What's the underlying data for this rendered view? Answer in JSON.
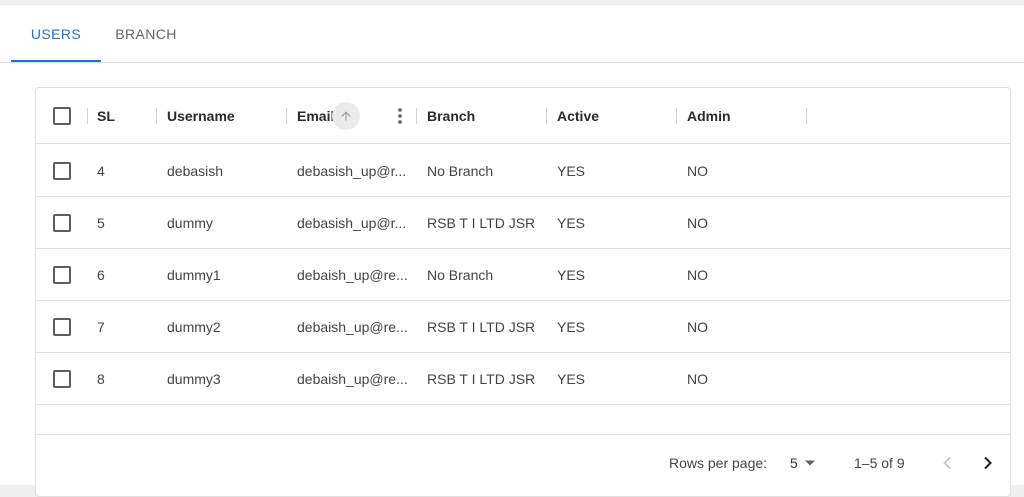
{
  "tabs": [
    {
      "label": "USERS",
      "active": true
    },
    {
      "label": "BRANCH",
      "active": false
    }
  ],
  "table": {
    "columns": [
      "SL",
      "Username",
      "Email",
      "Branch",
      "Active",
      "Admin"
    ],
    "rows": [
      {
        "sl": "4",
        "username": "debasish",
        "email": "debasish_up@r...",
        "branch": "No Branch",
        "active": "YES",
        "admin": "NO"
      },
      {
        "sl": "5",
        "username": "dummy",
        "email": "debasish_up@r...",
        "branch": "RSB T I LTD JSR",
        "active": "YES",
        "admin": "NO"
      },
      {
        "sl": "6",
        "username": "dummy1",
        "email": "debaish_up@re...",
        "branch": "No Branch",
        "active": "YES",
        "admin": "NO"
      },
      {
        "sl": "7",
        "username": "dummy2",
        "email": "debaish_up@re...",
        "branch": "RSB T I LTD JSR",
        "active": "YES",
        "admin": "NO"
      },
      {
        "sl": "8",
        "username": "dummy3",
        "email": "debaish_up@re...",
        "branch": "RSB T I LTD JSR",
        "active": "YES",
        "admin": "NO"
      }
    ]
  },
  "pagination": {
    "rows_per_page_label": "Rows per page:",
    "rows_per_page_value": "5",
    "range_label": "1–5 of 9"
  },
  "colors": {
    "accent": "#1976d2",
    "border": "#e0e0e0"
  },
  "icons": [
    "arrow-up-icon",
    "more-vert-icon",
    "caret-down-icon",
    "chevron-left-icon",
    "chevron-right-icon"
  ]
}
